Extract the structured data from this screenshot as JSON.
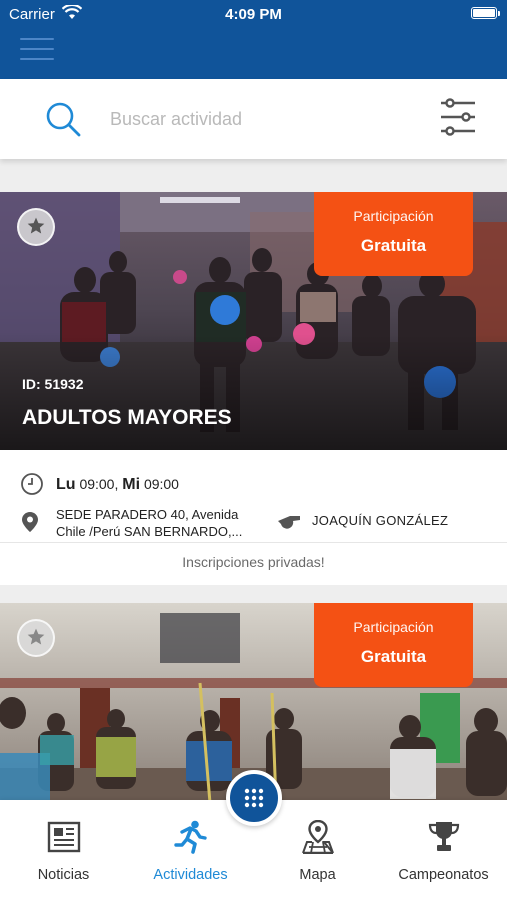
{
  "status_bar": {
    "carrier": "Carrier",
    "time": "4:09 PM"
  },
  "header": {
    "menu_icon": "hamburger-menu-icon"
  },
  "search": {
    "placeholder": "Buscar actividad",
    "value": "",
    "icon": "search-icon",
    "filter_icon": "filter-sliders-icon"
  },
  "activities": [
    {
      "id_label": "ID: 51932",
      "title": "ADULTOS MAYORES",
      "price_label": "Participación",
      "price_value": "Gratuita",
      "schedule": [
        {
          "day": "Lu",
          "time": "09:00"
        },
        {
          "day": "Mi",
          "time": "09:00"
        }
      ],
      "location": "SEDE PARADERO 40,  Avenida\nChile /Perú SAN BERNARDO,...",
      "instructor": "JOAQUÍN GONZÁLEZ",
      "enrollment_note": "Inscripciones privadas!"
    },
    {
      "price_label": "Participación",
      "price_value": "Gratuita"
    }
  ],
  "bottom_nav": {
    "items": [
      {
        "label": "Noticias",
        "icon": "newspaper-icon"
      },
      {
        "label": "Actividades",
        "icon": "running-person-icon",
        "active": true
      },
      {
        "label": "Mapa",
        "icon": "map-pin-icon"
      },
      {
        "label": "Campeonatos",
        "icon": "trophy-icon"
      }
    ],
    "fab_icon": "grid-dots-icon"
  },
  "colors": {
    "primary": "#10549a",
    "accent": "#f45114",
    "active_tab": "#1f8ad6"
  }
}
